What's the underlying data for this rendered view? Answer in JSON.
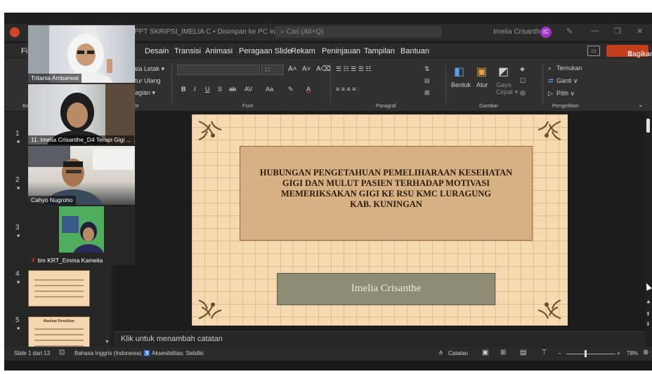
{
  "titlebar": {
    "doc_title": "PPT SKRIPSI_IMELIA C • Disimpan ke PC ini ∨",
    "search_placeholder": "Cari (Alt+Q)",
    "user_name": "Imelia Crisanthe",
    "user_initials": "IC"
  },
  "menu": {
    "file_partial": "Fi",
    "items": [
      "Desain",
      "Transisi",
      "Animasi",
      "Peragaan Slide",
      "Rekam",
      "Peninjauan",
      "Tampilan",
      "Bantuan"
    ],
    "share_label": "Bagikan"
  },
  "ribbon": {
    "slides_partial": [
      "ata Letak ▾",
      "tur Ulang",
      "agian ▾"
    ],
    "slides_group_label_partial": "le",
    "font_size_placeholder": "12",
    "font_group_label": "Font",
    "paragraph_group_label": "Paragraf",
    "drawing_buttons": [
      "Bentuk",
      "Atur",
      "Gaya Cepat ▾"
    ],
    "drawing_group_label": "Gambar",
    "editing_items": [
      "Temukan",
      "Ganti ∨",
      "Pilih ∨"
    ],
    "editing_group_label": "Pengeditan"
  },
  "sidebar": {
    "slide_numbers": [
      "1",
      "2",
      "3",
      "4",
      "5"
    ],
    "partial_label": "Ba",
    "thumb5_title": "Manfaat Penelitian"
  },
  "slide": {
    "title": "HUBUNGAN PENGETAHUAN PEMELIHARAAN KESEHATAN\nGIGI DAN MULUT PASIEN TERHADAP MOTIVASI\nMEMERIKSAKAN GIGI KE RSU KMC LURAGUNG\nKAB. KUNINGAN",
    "subtitle": "Imelia Crisanthe"
  },
  "notes": {
    "placeholder": "Klik untuk menambah catatan"
  },
  "status": {
    "slide_info": "Slide 1 dari 13",
    "language": "Bahasa Inggris (Indonesia)",
    "accessibility": "Aksesibilitas: Selidiki",
    "notes_btn": "Catatan",
    "zoom": "78%"
  },
  "participants": [
    {
      "name": "Tritania Ambarwat"
    },
    {
      "name": "11. Imelia Crisanthe_D4 Terapi Gigi ..."
    },
    {
      "name": "Cahyo Nugroho"
    },
    {
      "name": "tim KRT_Emma Kamelia"
    }
  ],
  "colors": {
    "share": "#c43e1c",
    "slide_bg": "#f5d9b1",
    "title_box": "#d7b183",
    "subtitle_box": "#8f8c74",
    "avatar": "#a334c9"
  }
}
